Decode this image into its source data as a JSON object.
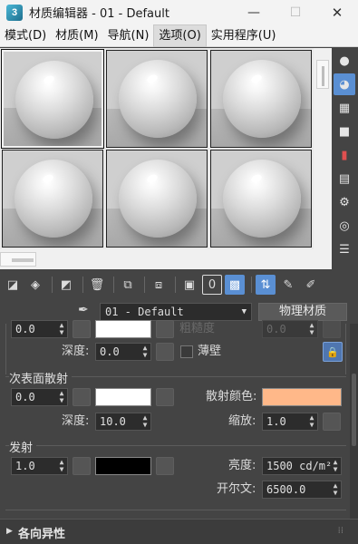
{
  "window": {
    "app_icon": "3",
    "title": "材质编辑器 - 01 - Default",
    "minimize": "—",
    "maximize": "☐",
    "close": "✕"
  },
  "menu": {
    "items": [
      "模式(D)",
      "材质(M)",
      "导航(N)",
      "选项(O)",
      "实用程序(U)"
    ]
  },
  "material": {
    "name": "01 - Default",
    "type_button": "物理材质"
  },
  "params": {
    "top_partial": {
      "left_value": "0.0",
      "dim_label": "粗糙度",
      "dim_value": "0.0",
      "depth_label": "深度:",
      "depth_value": "0.0",
      "thin_wall_label": "薄壁"
    },
    "sss": {
      "title": "次表面散射",
      "value": "0.0",
      "scatter_color_label": "散射颜色:",
      "scatter_color": "#ffb889",
      "base_color": "#ffffff",
      "depth_label": "深度:",
      "depth_value": "10.0",
      "scale_label": "缩放:",
      "scale_value": "1.0"
    },
    "emission": {
      "title": "发射",
      "value": "1.0",
      "color": "#000000",
      "luminance_label": "亮度:",
      "luminance_value": "1500 cd/m²",
      "kelvin_label": "开尔文:",
      "kelvin_value": "6500.0"
    }
  },
  "rollout": {
    "title": "各向异性"
  },
  "icons": {
    "right_toolbar": [
      "sample-type-sphere-icon",
      "backlight-icon",
      "background-checker-icon",
      "sample-uv-tiling-icon",
      "video-color-check-icon",
      "make-preview-icon",
      "options-icon",
      "select-by-material-icon",
      "material-navigator-icon"
    ],
    "bottom_toolbar": [
      "get-material-icon",
      "put-to-scene-icon",
      "assign-to-selection-icon",
      "reset-map-icon",
      "make-unique-icon",
      "put-to-library-icon",
      "material-id-channel-icon",
      "show-shaded-material-icon",
      "show-end-result-icon",
      "go-to-parent-icon",
      "go-forward-sibling-icon"
    ]
  }
}
